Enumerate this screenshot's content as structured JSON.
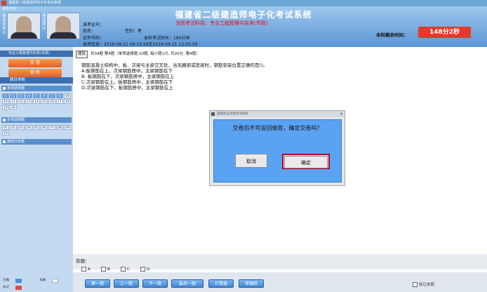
{
  "window": {
    "title": "福建省二级建造师电子化考试系统"
  },
  "header": {
    "candidate_label": "考生本机：",
    "side_captions": [
      "建造师照片",
      "考生照片"
    ],
    "system_title": "福建省二级建造师电子化考试系统",
    "subject_line": "当前考试科目：专业工程管理与实务(市政)",
    "exam_no": "准考证号：",
    "name": "姓名：",
    "gender": "性别：男",
    "id_no": "证件号码：",
    "duration": "本科考试时长：180分钟",
    "exam_time": "本场信息：2019-09-21 09:15:59至2019-09-21 12:25:59",
    "remain_label": "本科剩余时间：",
    "timer": "148分2秒"
  },
  "left": {
    "subject": "专业工程管理与实务(市政)",
    "submit_button": "交 卷",
    "refresh_button": "刷 新",
    "nav_header": "题目导航",
    "sections": [
      {
        "title": "单项选择题",
        "cells": [
          "01",
          "02",
          "03",
          "04",
          "05",
          "06",
          "07",
          "08",
          "09",
          "10",
          "11",
          "12",
          "13",
          "14",
          "15",
          "16",
          "17",
          "18",
          "19",
          "20"
        ]
      },
      {
        "title": "多项选择题",
        "cells": [
          "01",
          "02",
          "03",
          "04",
          "05",
          "06",
          "07",
          "08",
          "09",
          "10"
        ]
      },
      {
        "title": "案例分析题"
      }
    ],
    "legend": [
      "已做",
      "未做",
      "标记"
    ]
  },
  "question": {
    "tag": "题目",
    "bar_text": "共34题  第4题（单项选择题:20题, 每小题1分, 共20分, 第4题）",
    "stem": "钢筋混凝土结构中，板、次梁与主梁交叉处，当无圈梁或垫梁时，钢筋安装位置正确的是()。",
    "options": [
      "A:板钢筋在上，次梁钢筋居中，主梁钢筋在下",
      "B: 板钢筋在下，次梁钢筋居中，主梁钢筋在上",
      "C:次梁钢筋在上，板钢筋居中，主梁钢筋在下",
      "D:次梁钢筋在下，板钢筋居中，主梁钢筋在上"
    ]
  },
  "answer": {
    "label": "答题：",
    "choices": [
      "A",
      "B",
      "C",
      "D"
    ]
  },
  "bottom": {
    "first": "第一题",
    "prev": "上一题",
    "next": "下一题",
    "last": "最后一题",
    "calculator": "计算器",
    "draft": "草稿纸",
    "mark": "标记本题"
  },
  "dialog": {
    "title": "国家执业资格考试系统",
    "message": "交卷后不可返回做答，确定交卷吗？",
    "cancel": "取消",
    "ok": "确定"
  },
  "colors": {
    "header": "#5b95d3",
    "timer_bg": "#e23a2a",
    "panel": "#5aa3f2",
    "accent_red": "#b02222"
  }
}
